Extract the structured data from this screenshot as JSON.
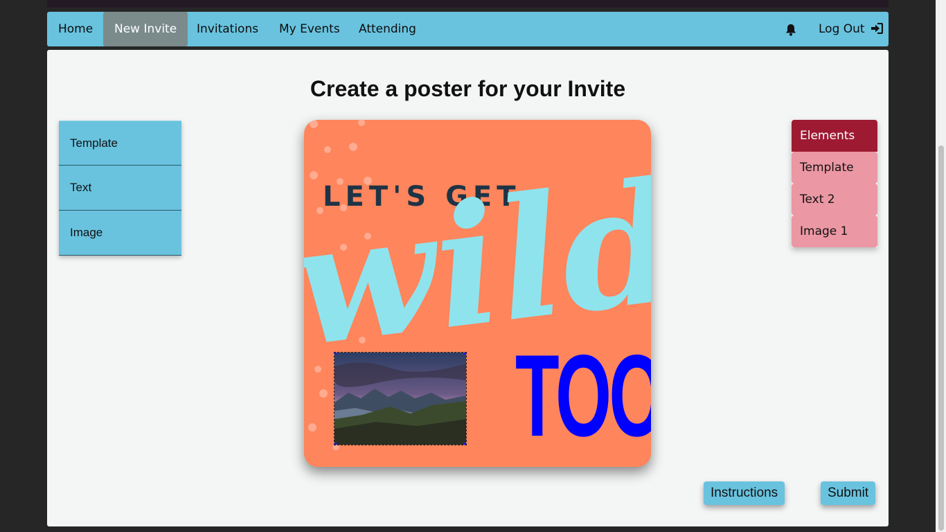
{
  "nav": {
    "items": [
      "Home",
      "New Invite",
      "Invitations",
      "My Events",
      "Attending"
    ],
    "active": "New Invite",
    "logout_label": "Log Out",
    "bell_icon": "bell-icon",
    "logout_icon": "sign-out-icon"
  },
  "page": {
    "title": "Create a poster for your Invite"
  },
  "tools": [
    "Template",
    "Text",
    "Image"
  ],
  "poster": {
    "text_top": "LET'S GET",
    "text_script": "wild",
    "text_big": "TOO",
    "background": "#fe855c",
    "script_color": "#8fe3ed",
    "big_text_color": "#0000ff"
  },
  "layers": {
    "header": "Elements",
    "items": [
      "Template",
      "Text 2",
      "Image 1"
    ]
  },
  "buttons": {
    "instructions": "Instructions",
    "submit": "Submit"
  },
  "colors": {
    "nav_bg": "#69c3df",
    "nav_active": "#7b8b8c",
    "layer_head": "#9e1a33",
    "layer_item": "#eb97a4"
  }
}
